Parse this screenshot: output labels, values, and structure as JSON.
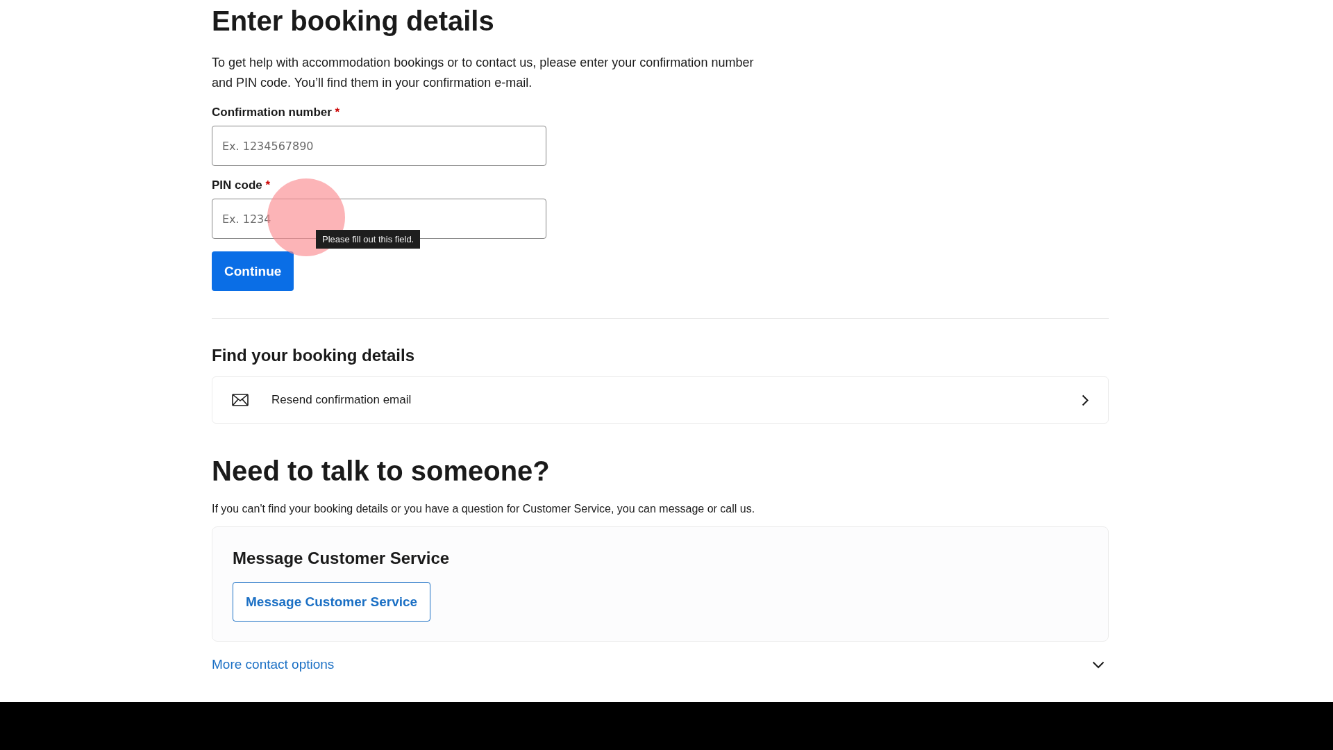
{
  "heading": "Enter booking details",
  "intro": "To get help with accommodation bookings or to contact us, please enter your confirmation number and PIN code. You’ll find them in your confirmation e-mail.",
  "fields": [
    {
      "label": "Confirmation number",
      "required_mark": "*",
      "placeholder": "Ex. 1234567890"
    },
    {
      "label": "PIN code",
      "required_mark": "*",
      "placeholder": "Ex. 1234",
      "tooltip": "Please fill out this field."
    }
  ],
  "continue_button": "Continue",
  "find_section": {
    "title": "Find your booking details",
    "items": [
      {
        "label": "Resend confirmation email"
      }
    ]
  },
  "talk_section": {
    "title": "Need to talk to someone?",
    "text": "If you can't find your booking details or you have a question for Customer Service, you can message or call us.",
    "card": {
      "title": "Message Customer Service",
      "button": "Message Customer Service"
    },
    "more_options": {
      "label": "More contact options",
      "expanded": false
    }
  }
}
